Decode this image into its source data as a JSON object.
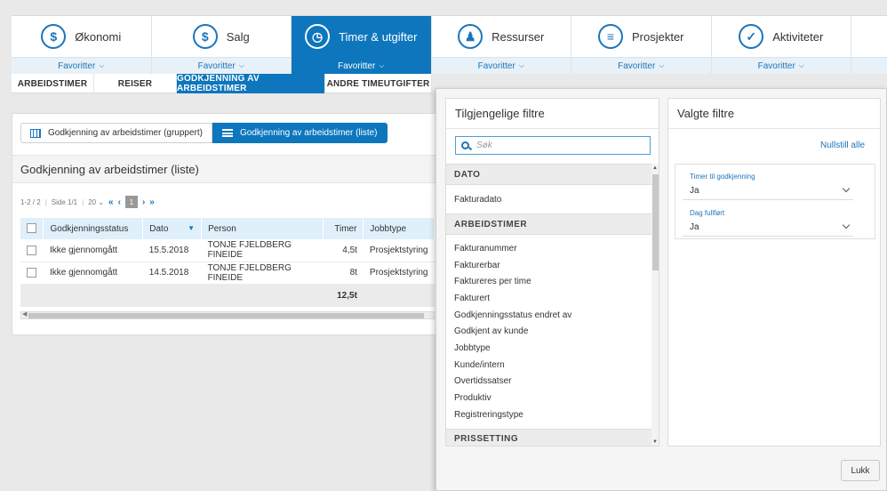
{
  "modules": [
    {
      "label": "Økonomi",
      "icon": "coins-icon",
      "favorites": "Favoritter",
      "active": false
    },
    {
      "label": "Salg",
      "icon": "dollar-icon",
      "favorites": "Favoritter",
      "active": false
    },
    {
      "label": "Timer & utgifter",
      "icon": "clock-icon",
      "favorites": "Favoritter",
      "active": true
    },
    {
      "label": "Ressurser",
      "icon": "people-icon",
      "favorites": "Favoritter",
      "active": false
    },
    {
      "label": "Prosjekter",
      "icon": "list-icon",
      "favorites": "Favoritter",
      "active": false
    },
    {
      "label": "Aktiviteter",
      "icon": "check-icon",
      "favorites": "Favoritter",
      "active": false
    }
  ],
  "subtabs": [
    "ARBEIDSTIMER",
    "REISER",
    "GODKJENNING AV ARBEIDSTIMER",
    "ANDRE TIMEUTGIFTER"
  ],
  "view_toggle": {
    "grouped": "Godkjenning av arbeidstimer (gruppert)",
    "list": "Godkjenning av arbeidstimer (liste)"
  },
  "card_title": "Godkjenning av arbeidstimer (liste)",
  "pager": {
    "range": "1-2 / 2",
    "page": "Side 1/1",
    "page_size": "20",
    "current": "1"
  },
  "table": {
    "columns": [
      "Godkjenningsstatus",
      "Dato",
      "Person",
      "Timer",
      "Jobbtype"
    ],
    "rows": [
      [
        "Ikke gjennomgått",
        "15.5.2018",
        "TONJE FJELDBERG FINEIDE",
        "4,5t",
        "Prosjektstyring"
      ],
      [
        "Ikke gjennomgått",
        "14.5.2018",
        "TONJE FJELDBERG FINEIDE",
        "8t",
        "Prosjektstyring"
      ]
    ],
    "total": "12,5t"
  },
  "available_filters": {
    "title": "Tilgjengelige filtre",
    "search_placeholder": "Søk",
    "groups": [
      {
        "name": "DATO",
        "items": [
          "Fakturadato"
        ]
      },
      {
        "name": "ARBEIDSTIMER",
        "items": [
          "Fakturanummer",
          "Fakturerbar",
          "Faktureres per time",
          "Fakturert",
          "Godkjenningsstatus endret av",
          "Godkjent av kunde",
          "Jobbtype",
          "Kunde/intern",
          "Overtidssatser",
          "Produktiv",
          "Registreringstype"
        ]
      },
      {
        "name": "PRISSETTING",
        "items": []
      }
    ]
  },
  "selected_filters": {
    "title": "Valgte filtre",
    "reset_all": "Nullstill alle",
    "filters": [
      {
        "label": "Timer til godkjenning",
        "value": "Ja"
      },
      {
        "label": "Dag fullført",
        "value": "Ja"
      }
    ]
  },
  "close_label": "Lukk",
  "colors": {
    "accent": "#0d76bd",
    "link": "#1b75bb",
    "header_bg": "#dff0fa"
  }
}
